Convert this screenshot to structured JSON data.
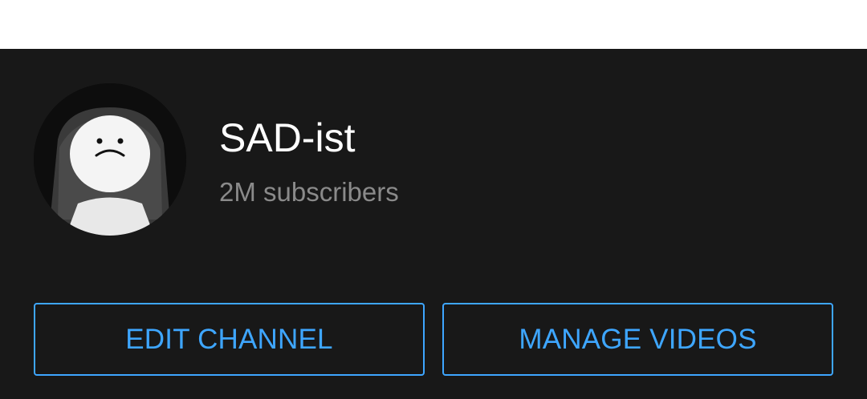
{
  "channel": {
    "name": "SAD-ist",
    "subscribers": "2M subscribers",
    "avatar_icon": "channel-avatar"
  },
  "actions": {
    "edit_label": "EDIT CHANNEL",
    "manage_label": "MANAGE VIDEOS"
  },
  "colors": {
    "accent": "#3ea6ff",
    "background": "#181818",
    "subtext": "#8a8a8a"
  }
}
